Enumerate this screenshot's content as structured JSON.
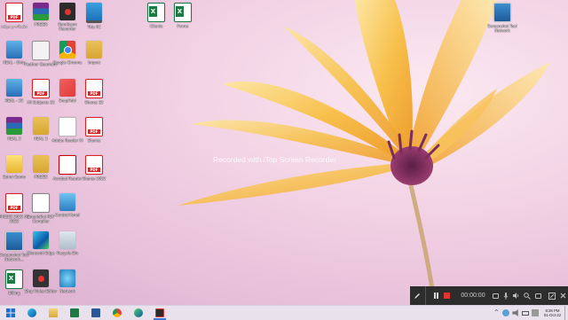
{
  "desktop_icons": [
    {
      "label": "تطبيقات و مرفقة",
      "icon": "pdf-icon"
    },
    {
      "label": "PRIZES",
      "icon": "winrar-icon"
    },
    {
      "label": "Bandicam Recorder",
      "icon": "screen-recorder-icon"
    },
    {
      "label": "This PC",
      "icon": "this-pc-icon"
    },
    {
      "label": "Clients",
      "icon": "excel-icon"
    },
    {
      "label": "Forms",
      "icon": "excel-icon"
    },
    {
      "label": "Screenshot Tool Network",
      "icon": "screen-tool-icon"
    },
    {
      "label": "REAL - Ohio",
      "icon": "ruler-icon"
    },
    {
      "label": "Feather Quantum",
      "icon": "feather-icon"
    },
    {
      "label": "Google Chrome",
      "icon": "chrome-icon"
    },
    {
      "label": "Import",
      "icon": "folder-icon"
    },
    {
      "label": "REAL - 32",
      "icon": "ruler-icon"
    },
    {
      "label": "All Subjects 32",
      "icon": "pdf-icon"
    },
    {
      "label": "SnapFold",
      "icon": "sharex-icon"
    },
    {
      "label": "Shares 32",
      "icon": "pdf-icon"
    },
    {
      "label": "REAL 3",
      "icon": "winrar-icon"
    },
    {
      "label": "REAL 3",
      "icon": "folder-icon"
    },
    {
      "label": "Adobe Reader XI",
      "icon": "document-icon"
    },
    {
      "label": "Shares",
      "icon": "pdf-icon"
    },
    {
      "label": "Sumo Sumo",
      "icon": "sumatra-icon"
    },
    {
      "label": "PRIZES",
      "icon": "folder-icon"
    },
    {
      "label": "Acrobat Reader",
      "icon": "acrobat-icon"
    },
    {
      "label": "Shares 2022",
      "icon": "pdf-icon"
    },
    {
      "label": "PRIZES 2022 08 2022",
      "icon": "pdf-icon"
    },
    {
      "label": "SimpleBot PDF Compiler",
      "icon": "ebook-icon"
    },
    {
      "label": "Control Panel",
      "icon": "control-panel-icon"
    },
    {
      "label": "Screenshot Tool Network...",
      "icon": "screen-tool-icon"
    },
    {
      "label": "Microsoft Edge",
      "icon": "edge-icon"
    },
    {
      "label": "Recycle Bin",
      "icon": "recycle-bin-icon"
    },
    {
      "label": "Billing",
      "icon": "excel-icon"
    },
    {
      "label": "Stop Video Editor",
      "icon": "video-recorder-icon"
    },
    {
      "label": "Network",
      "icon": "network-icon"
    }
  ],
  "watermark": "Recorded with iTop Screen Recorder",
  "recorder_bar": {
    "timer": "00:00:00",
    "icons": [
      "pen-icon",
      "pause-icon",
      "stop-icon",
      "camera-icon",
      "microphone-icon",
      "speaker-icon",
      "zoom-icon",
      "screenshot-icon",
      "edit-icon",
      "close-icon"
    ]
  },
  "taskbar": {
    "apps": [
      "start-icon",
      "edge-icon",
      "file-explorer-icon",
      "excel-icon",
      "word-icon",
      "chrome-icon",
      "edge-icon",
      "screen-recorder-icon"
    ],
    "tray": [
      "chevron-up-icon",
      "network-icon",
      "speaker-icon",
      "battery-icon",
      "language-icon"
    ],
    "clock_time": "8:28 PM",
    "clock_date": "01-Oct-22"
  },
  "colors": {
    "wallpaper_pink": "#f1cfe3",
    "flower_yellow": "#f5b53d",
    "flower_center": "#7a2c5a",
    "taskbar": "#e9e2ec",
    "recorder_bar": "#2d2d2d",
    "record_red": "#e3342f"
  }
}
